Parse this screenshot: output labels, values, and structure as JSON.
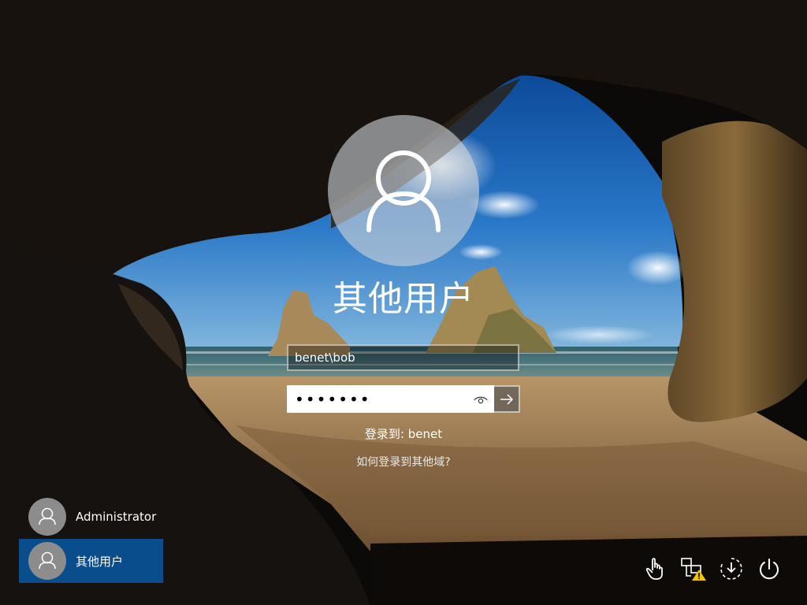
{
  "login": {
    "username": "其他用户",
    "user_field_value": "benet\\bob",
    "password_value": "•••••••",
    "sign_in_to": "登录到: benet",
    "other_domain_link": "如何登录到其他域?"
  },
  "user_list": [
    {
      "label": "Administrator",
      "selected": false
    },
    {
      "label": "其他用户",
      "selected": true
    }
  ],
  "system_tray": {
    "icons": [
      "ease-of-access-icon",
      "network-warning-icon",
      "accessibility-icon",
      "power-icon"
    ]
  },
  "colors": {
    "selected_tile": "#0a4d8c",
    "warning": "#f2c500"
  }
}
